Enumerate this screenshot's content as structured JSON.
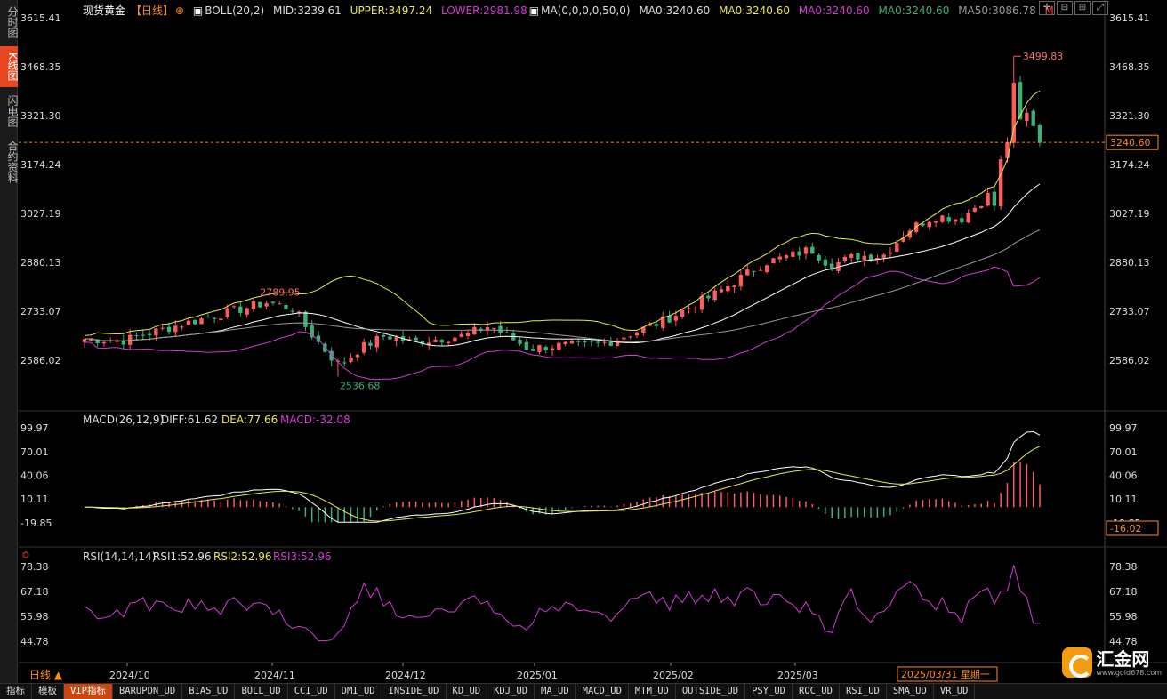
{
  "sidebar": {
    "tabs": [
      {
        "label": "分时图",
        "active": false
      },
      {
        "label": "K线图",
        "active": true
      },
      {
        "label": "闪电图",
        "active": false
      },
      {
        "label": "合约资料",
        "active": false
      }
    ]
  },
  "header": {
    "symbol": "现货黄金",
    "period_tag": "【日线】",
    "boll_label": "BOLL(20,2)",
    "mid": "MID:3239.61",
    "upper": "UPPER:3497.24",
    "lower": "LOWER:2981.98",
    "ma_label": "MA(0,0,0,0,50,0)",
    "ma0_a": "MA0:3240.60",
    "ma0_b": "MA0:3240.60",
    "ma0_c": "MA0:3240.60",
    "ma0_d": "MA0:3240.60",
    "ma50": "MA50:3086.78",
    "m_flag": "M"
  },
  "price_axis": {
    "ticks": [
      "3615.41",
      "3468.35",
      "3321.30",
      "3174.24",
      "3027.19",
      "2880.13",
      "2733.07",
      "2586.02"
    ],
    "current": "3240.60"
  },
  "annotations": {
    "high": "3499.83",
    "mid_high": "2789.95",
    "low": "2536.68"
  },
  "macd": {
    "label": "MACD(26,12,9)",
    "diff": "DIFF:61.62",
    "dea": "DEA:77.66",
    "macd": "MACD:-32.08",
    "ticks": [
      "99.97",
      "70.01",
      "40.06",
      "10.11",
      "-19.85"
    ],
    "current": "-16.02"
  },
  "rsi": {
    "label": "RSI(14,14,14)",
    "rsi1": "RSI1:52.96",
    "rsi2": "RSI2:52.96",
    "rsi3": "RSI3:52.96",
    "ticks": [
      "78.38",
      "67.18",
      "55.98",
      "44.78"
    ]
  },
  "time_axis": {
    "period": "日线 ▲",
    "labels": [
      "2024/10",
      "2024/11",
      "2024/12",
      "2025/01",
      "2025/02",
      "2025/03"
    ],
    "cursor_date": "2025/03/31 星期一"
  },
  "bottom_tabs": [
    "指标",
    "模板",
    "VIP指标",
    "BARUPDN_UD",
    "BIAS_UD",
    "BOLL_UD",
    "CCI_UD",
    "DMI_UD",
    "INSIDE_UD",
    "KD_UD",
    "KDJ_UD",
    "MA_UD",
    "MACD_UD",
    "MTM_UD",
    "OUTSIDE_UD",
    "PSY_UD",
    "ROC_UD",
    "RSI_UD",
    "SMA_UD",
    "VR_UD"
  ],
  "logo": {
    "text": "汇金网",
    "url": "www.gold678.com"
  },
  "colors": {
    "up": "#ff5b5b",
    "down": "#3cb179",
    "boll_upper": "#e8e84a",
    "boll_mid": "#ffffff",
    "boll_lower": "#d33bd3",
    "ma50": "#999999",
    "accent": "#ff8c1a"
  }
}
